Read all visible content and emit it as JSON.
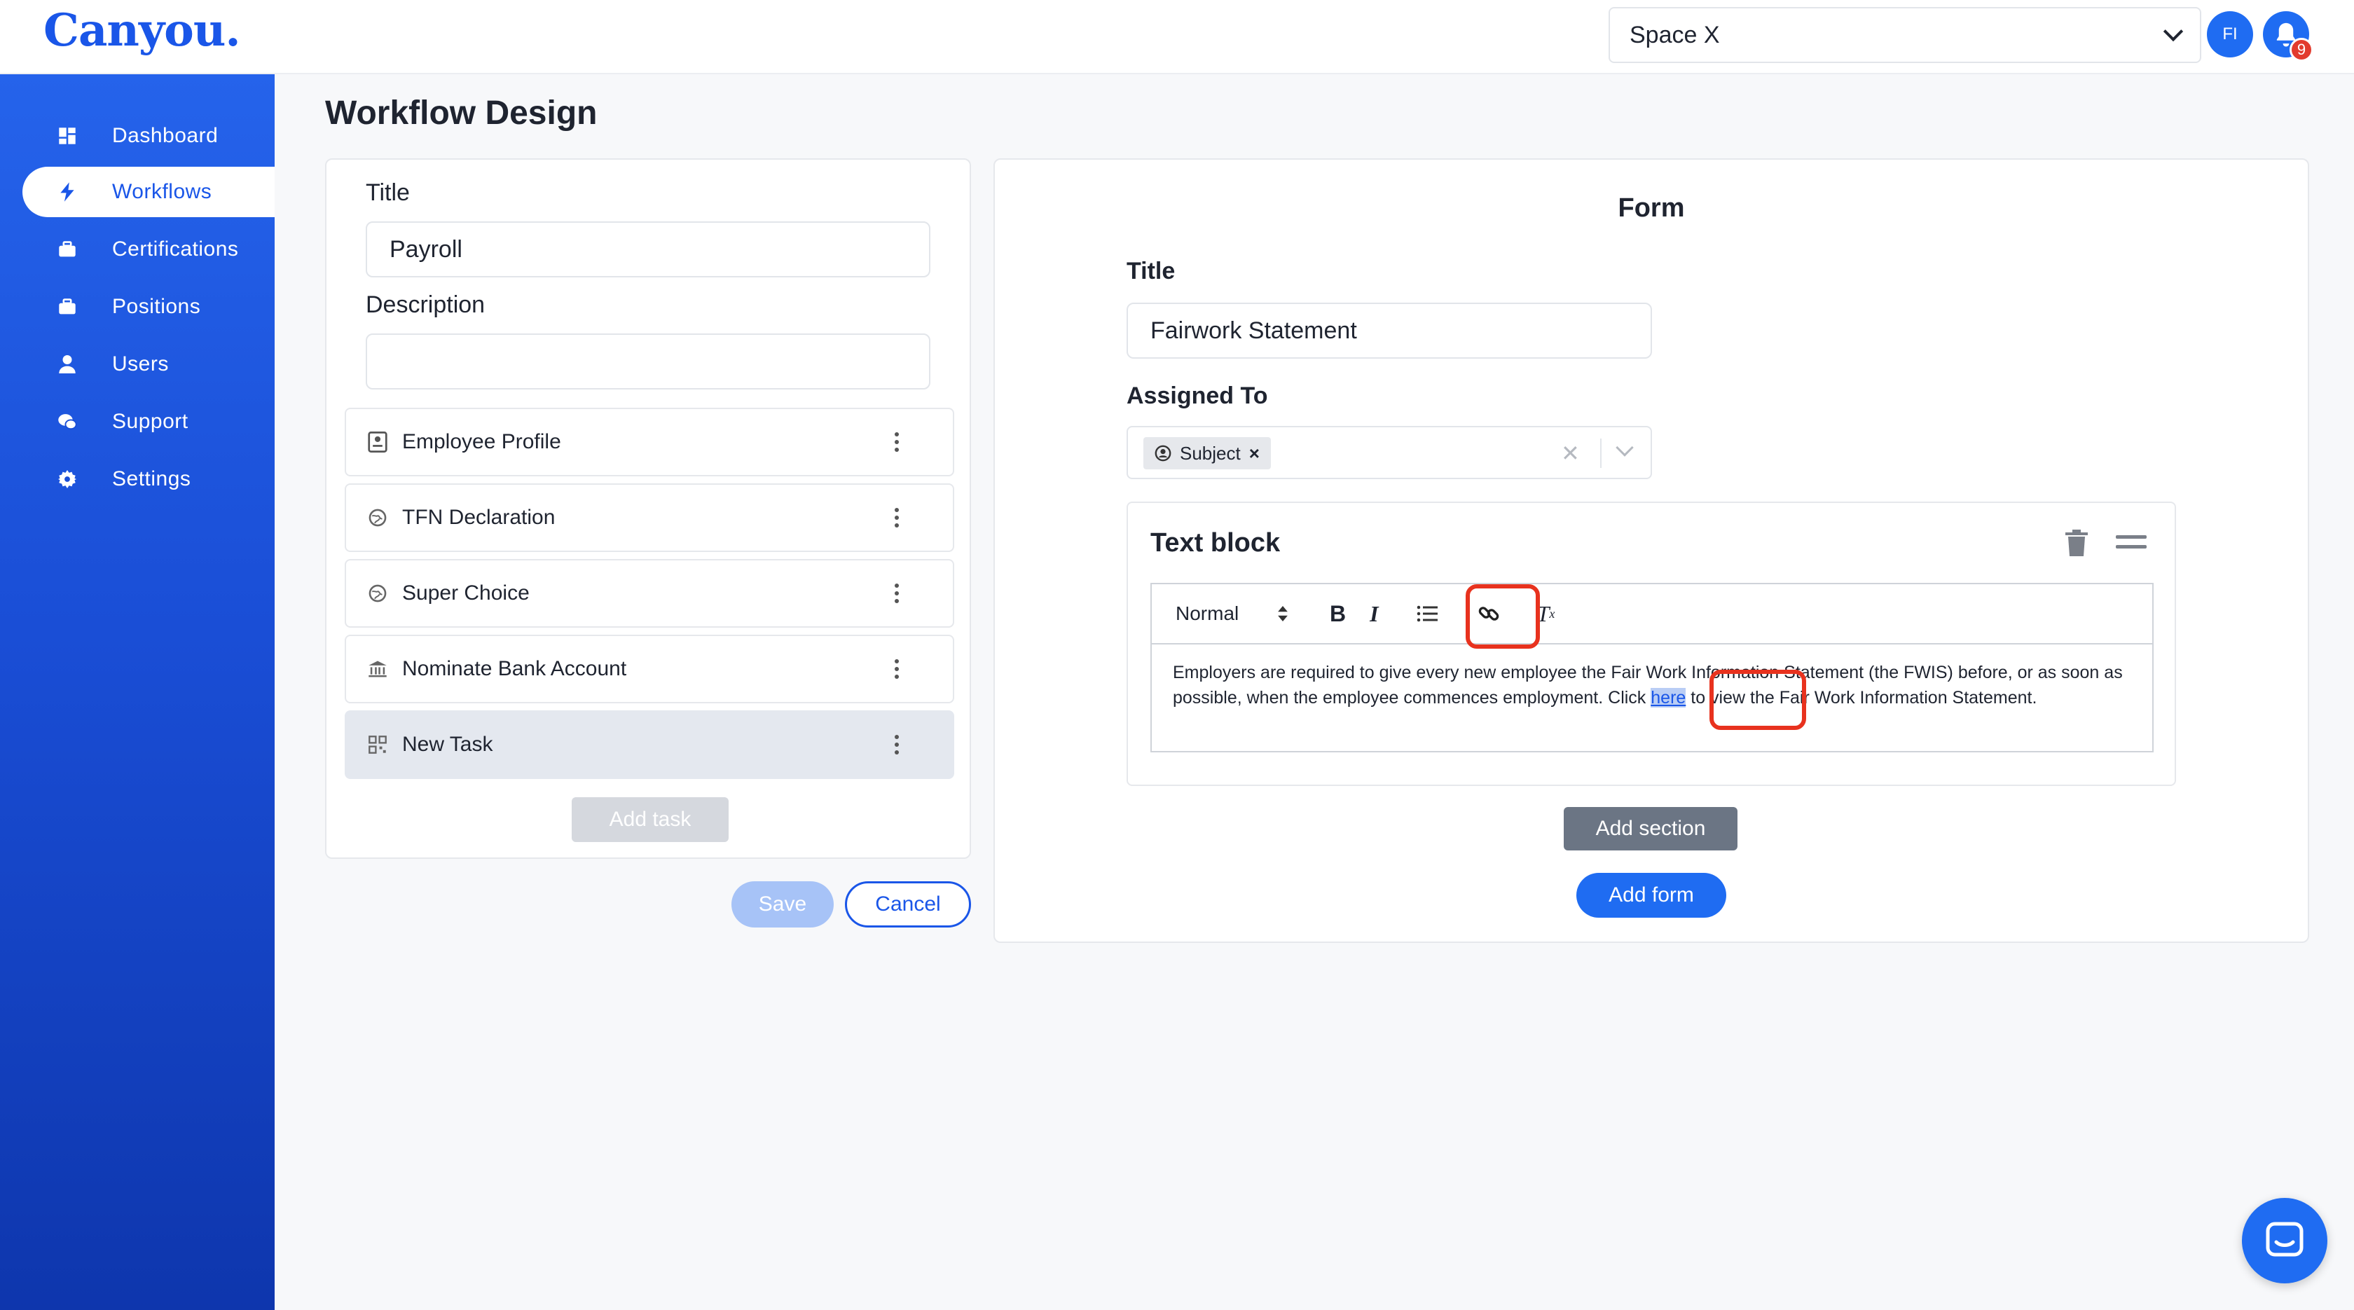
{
  "app": {
    "logo": "Canyou."
  },
  "header": {
    "space_select": "Space X",
    "avatar_initials": "FI",
    "notification_count": "9"
  },
  "sidebar": {
    "items": [
      {
        "label": "Dashboard",
        "icon": "grid-icon",
        "active": false
      },
      {
        "label": "Workflows",
        "icon": "bolt-icon",
        "active": true
      },
      {
        "label": "Certifications",
        "icon": "briefcase-icon",
        "active": false
      },
      {
        "label": "Positions",
        "icon": "briefcase-icon",
        "active": false
      },
      {
        "label": "Users",
        "icon": "user-icon",
        "active": false
      },
      {
        "label": "Support",
        "icon": "chat-icon",
        "active": false
      },
      {
        "label": "Settings",
        "icon": "gear-icon",
        "active": false
      }
    ]
  },
  "page": {
    "title": "Workflow Design"
  },
  "workflow": {
    "title_label": "Title",
    "title_value": "Payroll",
    "description_label": "Description",
    "description_value": "",
    "tasks": [
      {
        "label": "Employee Profile",
        "icon": "profile-icon"
      },
      {
        "label": "TFN Declaration",
        "icon": "globe-icon"
      },
      {
        "label": "Super Choice",
        "icon": "globe-icon"
      },
      {
        "label": "Nominate Bank Account",
        "icon": "bank-icon"
      },
      {
        "label": "New Task",
        "icon": "qr-icon",
        "selected": true
      }
    ],
    "add_task_label": "Add task",
    "save_label": "Save",
    "cancel_label": "Cancel"
  },
  "form": {
    "heading": "Form",
    "title_label": "Title",
    "title_value": "Fairwork Statement",
    "assigned_label": "Assigned To",
    "assigned_chip": "Subject",
    "text_block": {
      "title": "Text block",
      "format_value": "Normal",
      "text_before": "Employers are required to give every new employee the Fair Work Information Statement (the FWIS) before, or as soon as possible, when the employee commences employment. Click ",
      "link_text": "here",
      "text_after": " to view the Fair Work Information Statement."
    },
    "add_section_label": "Add section",
    "add_form_label": "Add form"
  },
  "colors": {
    "primary": "#1f6cf2",
    "sidebar_top": "#2563eb",
    "sidebar_bottom": "#0e36ad",
    "highlight": "#e8321e"
  }
}
